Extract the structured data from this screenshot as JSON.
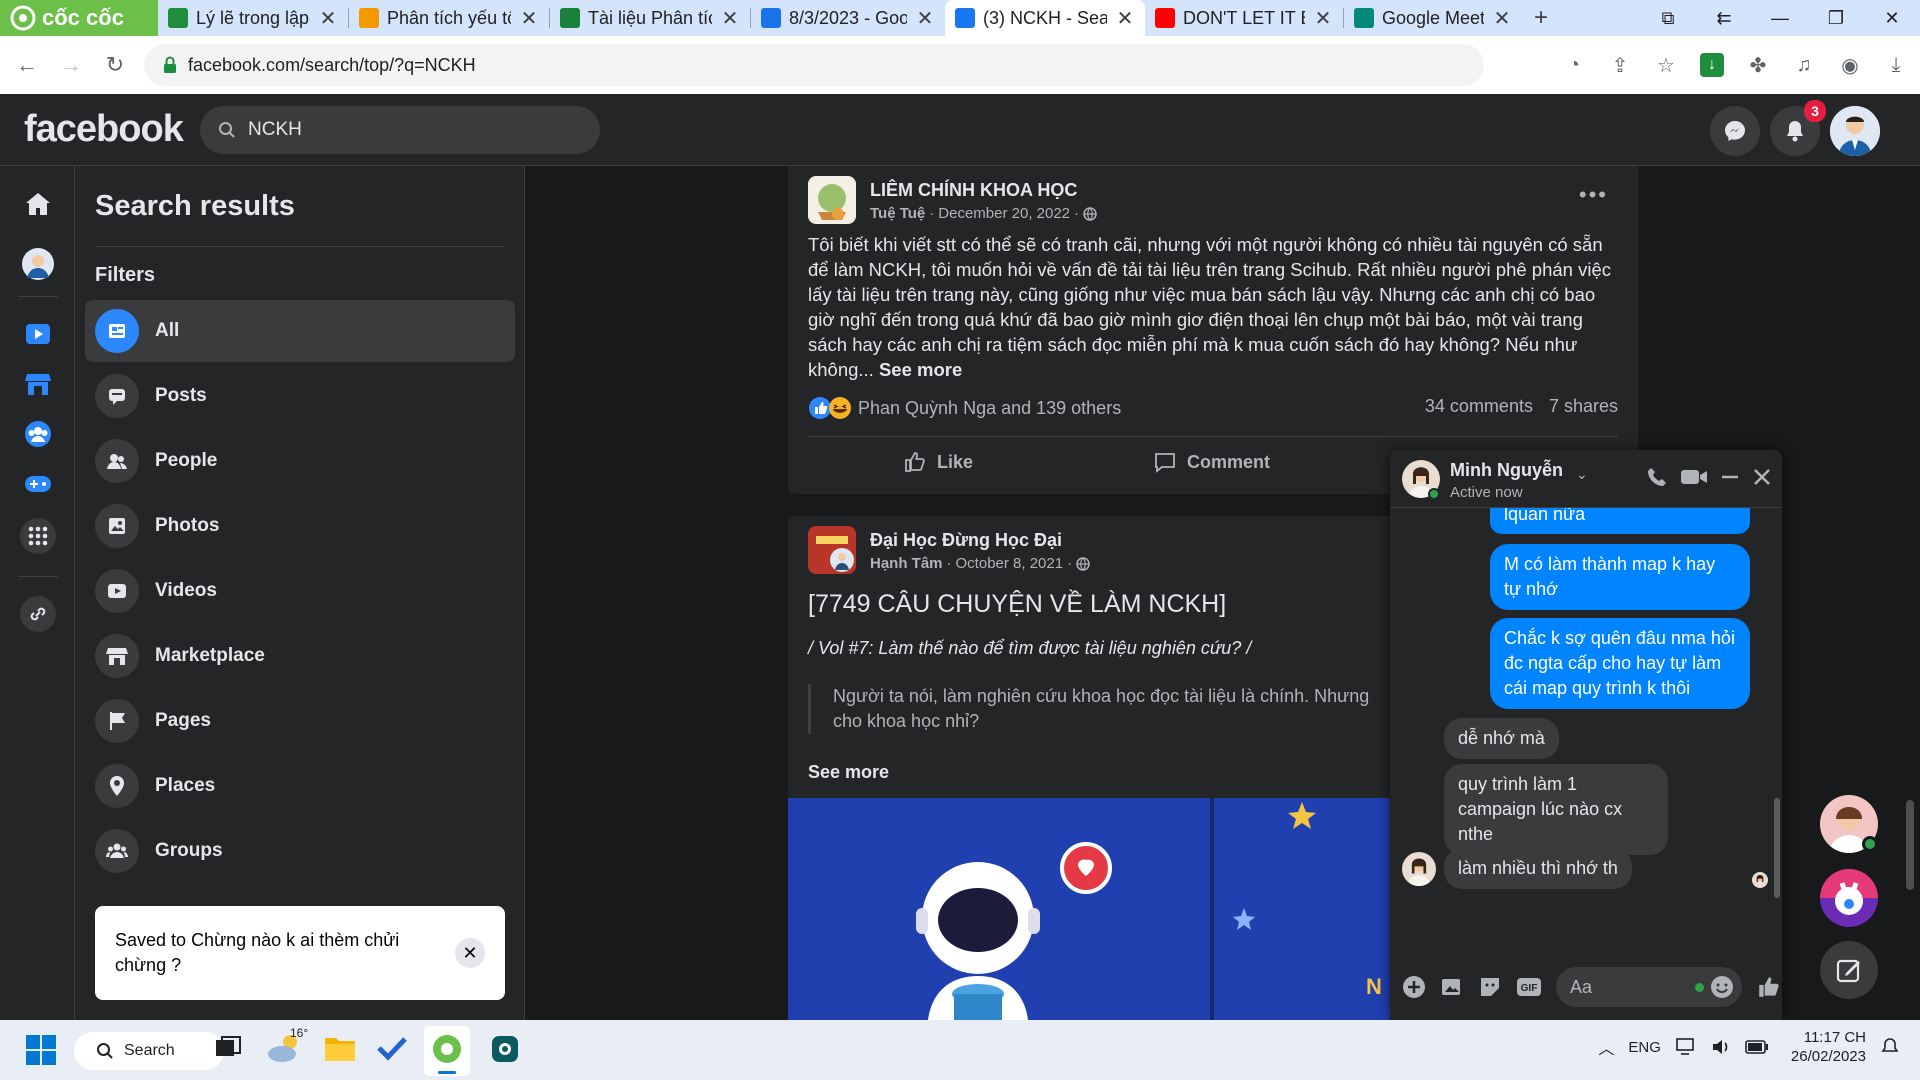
{
  "browser": {
    "brand": "cốc cốc",
    "tabs": [
      {
        "title": "Lý lẽ trong lập l",
        "icon": "sheets-icon",
        "color": "#1e8e3e"
      },
      {
        "title": "Phân tích yếu tố",
        "icon": "numbers-icon",
        "color": "#f29900"
      },
      {
        "title": "Tài liệu Phân tích",
        "icon": "docs-icon",
        "color": "#188038"
      },
      {
        "title": "8/3/2023 - Goo",
        "icon": "docs-icon",
        "color": "#1a73e8"
      },
      {
        "title": "(3) NCKH - Sear",
        "icon": "facebook-icon",
        "color": "#1877f2"
      },
      {
        "title": "DON'T LET IT B",
        "icon": "youtube-icon",
        "color": "#ff0000"
      },
      {
        "title": "Google Meet",
        "icon": "meet-icon",
        "color": "#00897b"
      }
    ],
    "url": "facebook.com/search/top/?q=NCKH"
  },
  "facebook": {
    "logo": "facebook",
    "search_value": "NCKH",
    "notif_count": "3"
  },
  "panel": {
    "title": "Search results",
    "filters_label": "Filters",
    "filters": [
      {
        "label": "All",
        "icon": "all-results-icon"
      },
      {
        "label": "Posts",
        "icon": "posts-icon"
      },
      {
        "label": "People",
        "icon": "people-icon"
      },
      {
        "label": "Photos",
        "icon": "photos-icon"
      },
      {
        "label": "Videos",
        "icon": "videos-icon"
      },
      {
        "label": "Marketplace",
        "icon": "marketplace-icon"
      },
      {
        "label": "Pages",
        "icon": "pages-icon"
      },
      {
        "label": "Places",
        "icon": "places-icon"
      },
      {
        "label": "Groups",
        "icon": "groups-icon"
      }
    ]
  },
  "toast": {
    "prefix": "Saved to ",
    "collection": "Chừng nào k ai thèm chửi chừng ?"
  },
  "post1": {
    "page": "LIÊM CHÍNH KHOA HỌC",
    "author": "Tuệ Tuệ",
    "date": "December 20, 2022",
    "text": "Tôi biết khi viết stt có thể sẽ có tranh cãi, nhưng với một người không có nhiều tài nguyên có sẵn để làm NCKH, tôi muốn hỏi về vấn đề tải tài liệu trên trang Scihub. Rất nhiều người phê phán việc lấy tài liệu trên trang này, cũng giống như việc mua bán sách lậu vậy. Nhưng các anh chị có bao giờ nghĩ đến trong quá khứ đã bao giờ mình giơ điện thoại lên chụp một bài báo, một vài trang sách hay các anh chị ra tiệm sách đọc miễn phí mà k mua cuốn sách đó hay không? Nếu như không...",
    "see_more": "See more",
    "reactions": "Phan Quỳnh Nga and 139 others",
    "comments": "34 comments",
    "shares": "7 shares",
    "like": "Like",
    "comment": "Comment"
  },
  "post2": {
    "page": "Đại Học Đừng Học Đại",
    "author": "Hạnh Tâm",
    "date": "October 8, 2021",
    "headline": "[7749 CÂU CHUYỆN VỀ LÀM NCKH]",
    "subtitle": "/ Vol #7: Làm thế nào để tìm được tài liệu nghiên cứu? /",
    "quote": "Người ta nói, làm nghiên cứu khoa học đọc tài liệu là chính. Nhưng cho khoa học nhỉ?",
    "see_more": "See more",
    "image_partial_text": "N"
  },
  "chat": {
    "name": "Minh Nguyễn",
    "status": "Active now",
    "messages": [
      {
        "from": "me",
        "text": "lquan nữa"
      },
      {
        "from": "me",
        "text": "M có làm thành map k hay tự nhớ"
      },
      {
        "from": "me",
        "text": "Chắc k sợ quên đâu nma hỏi đc ngta cấp cho hay tự làm cái map quy trình k thôi"
      },
      {
        "from": "them",
        "text": "dễ nhớ mà"
      },
      {
        "from": "them",
        "text": "quy trình làm 1 campaign lúc nào cx nthe"
      },
      {
        "from": "them",
        "text": "làm nhiều thì nhớ th"
      }
    ],
    "input_placeholder": "Aa"
  },
  "taskbar": {
    "search": "Search",
    "weather": "16°",
    "lang": "ENG",
    "time": "11:17 CH",
    "date": "26/02/2023"
  }
}
